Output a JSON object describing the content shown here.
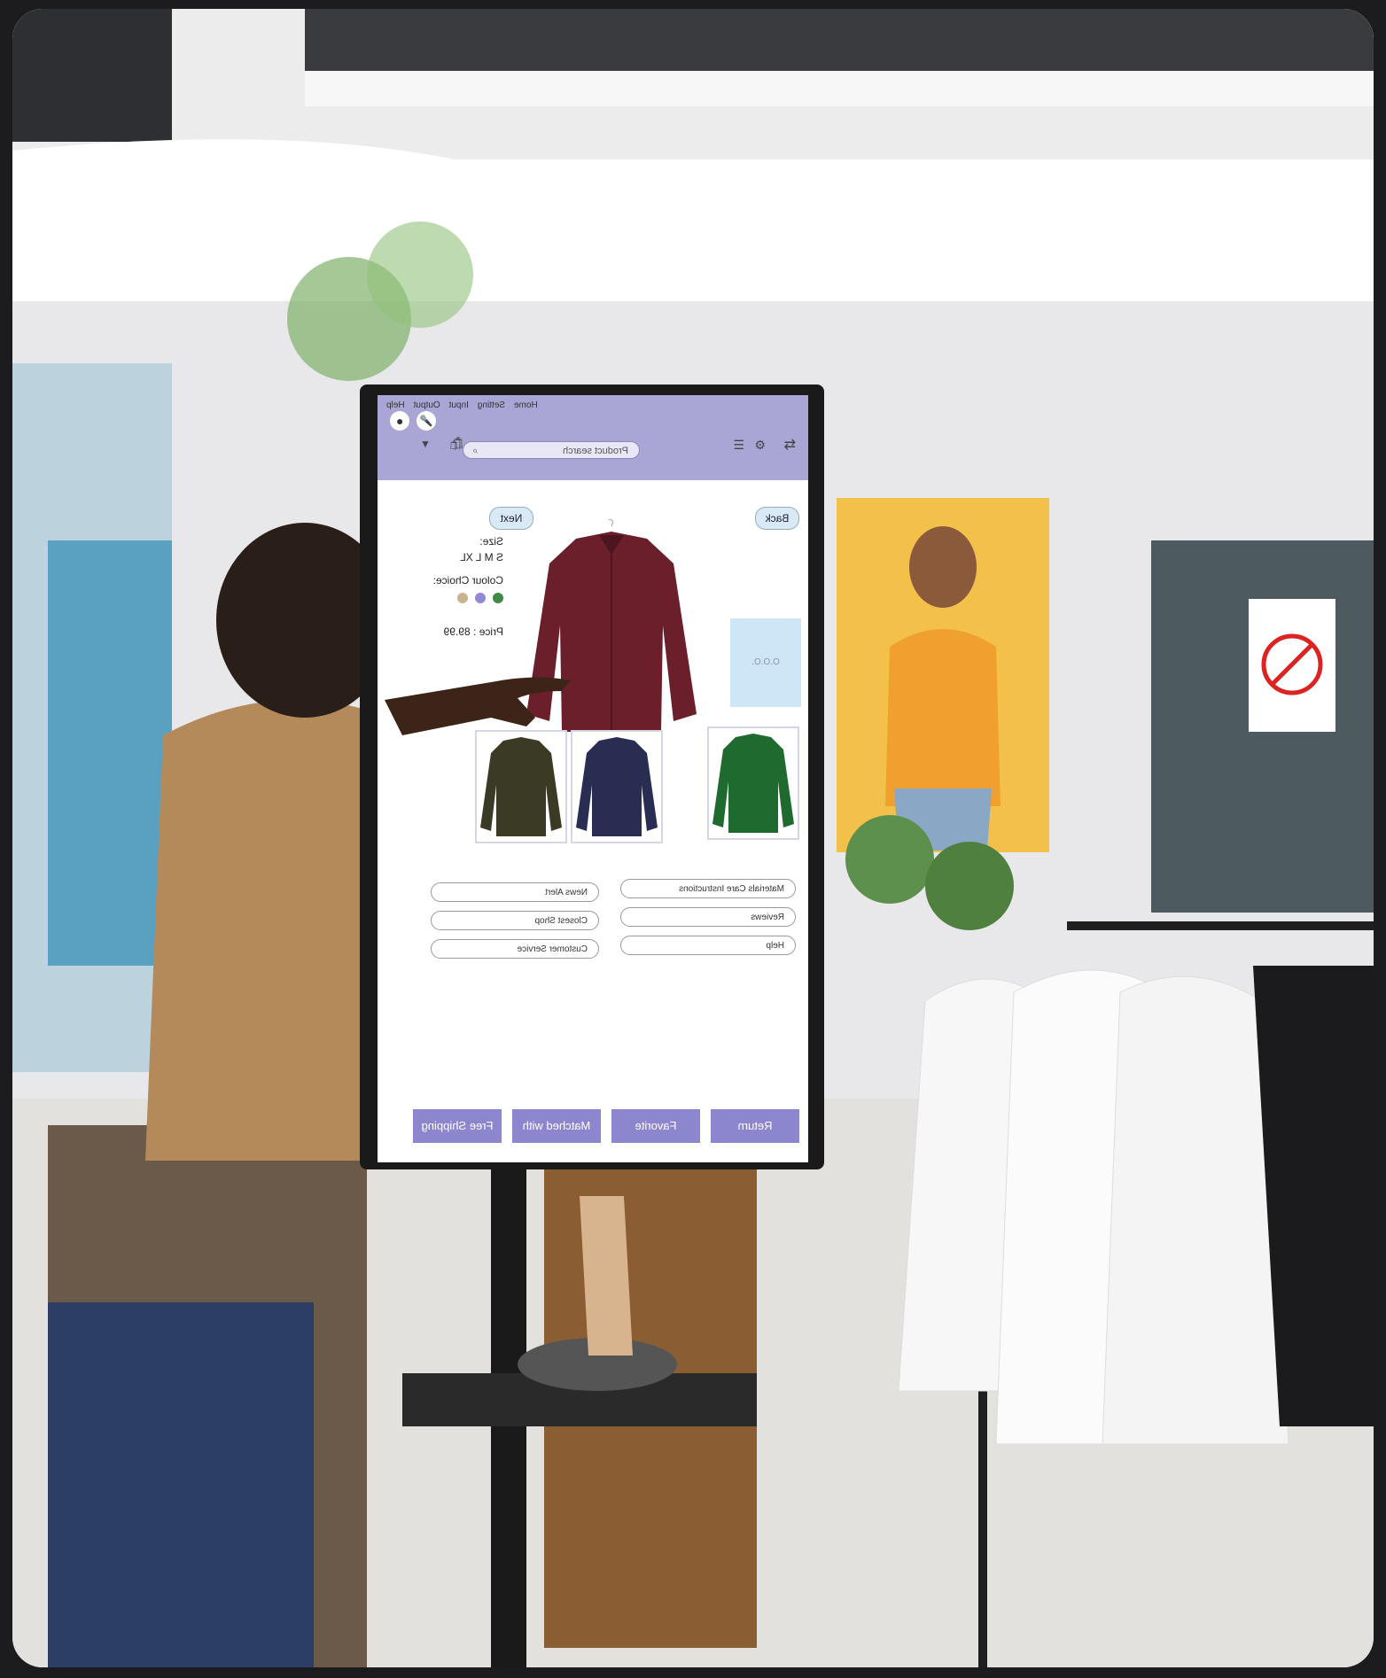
{
  "kiosk": {
    "menu": [
      "Home",
      "Setting",
      "Input",
      "Output",
      "Help"
    ],
    "search_placeholder": "Product search",
    "nav": {
      "back": "Back",
      "next": "Next"
    },
    "product": {
      "size_label": "Size:",
      "sizes": "S  M  L  XL",
      "colour_label": "Colour Choice:",
      "colours": [
        "#3f8a45",
        "#8f89d6",
        "#c8b48f"
      ],
      "price": "Price : 89.99"
    },
    "side_panel": "O.O.O.",
    "links_left": [
      "News Alert",
      "Closest Shop",
      "Customer Service"
    ],
    "links_right": [
      "Materials Care Instructions",
      "Reviews",
      "Help"
    ],
    "buttons": [
      "Return",
      "Favorite",
      "Matched with",
      "Free Shipping"
    ]
  }
}
